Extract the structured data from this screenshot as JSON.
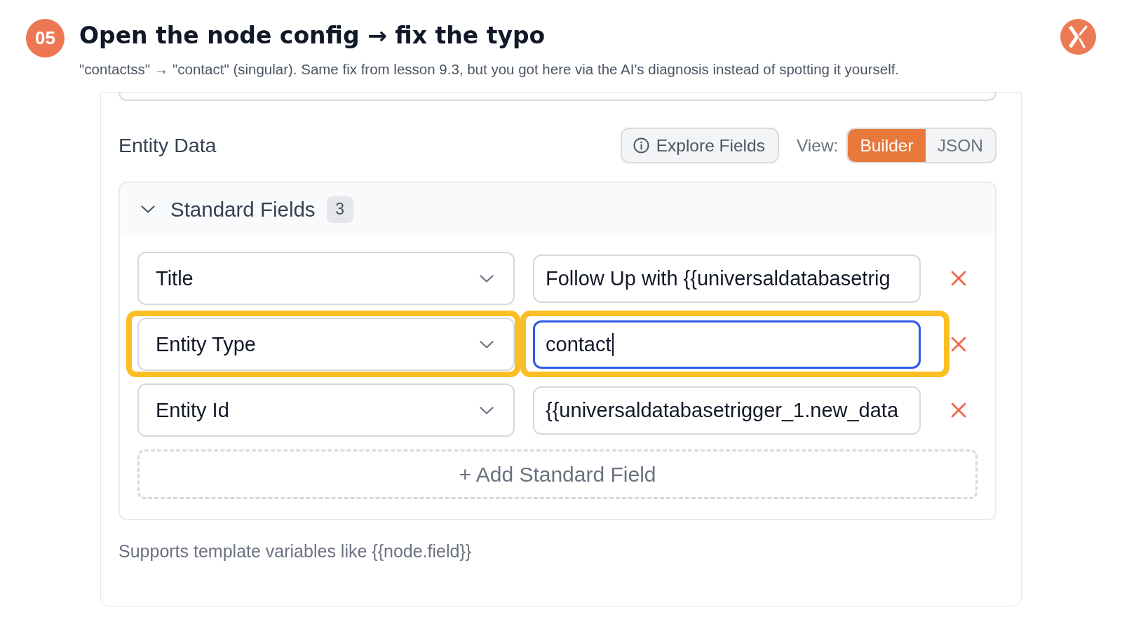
{
  "step": {
    "number": "05",
    "title": "Open the node config → fix the typo",
    "subtitle": "\"contactss\" → \"contact\" (singular). Same fix from lesson 9.3, but you got here via the AI's diagnosis instead of spotting it yourself."
  },
  "config": {
    "section_title": "Entity Data",
    "explore_button": "Explore Fields",
    "view_label": "View:",
    "view_options": [
      {
        "label": "Builder",
        "selected": true
      },
      {
        "label": "JSON",
        "selected": false
      }
    ],
    "group": {
      "title": "Standard Fields",
      "count": "3",
      "expanded": true,
      "rows": [
        {
          "field": "Title",
          "value": "Follow Up with {{universaldatabasetrig",
          "focused": false,
          "highlighted": false
        },
        {
          "field": "Entity Type",
          "value": "contact",
          "focused": true,
          "highlighted": true
        },
        {
          "field": "Entity Id",
          "value": "{{universaldatabasetrigger_1.new_data",
          "focused": false,
          "highlighted": false
        }
      ],
      "add_button": "+ Add Standard Field"
    },
    "hint": "Supports template variables like {{node.field}}"
  }
}
